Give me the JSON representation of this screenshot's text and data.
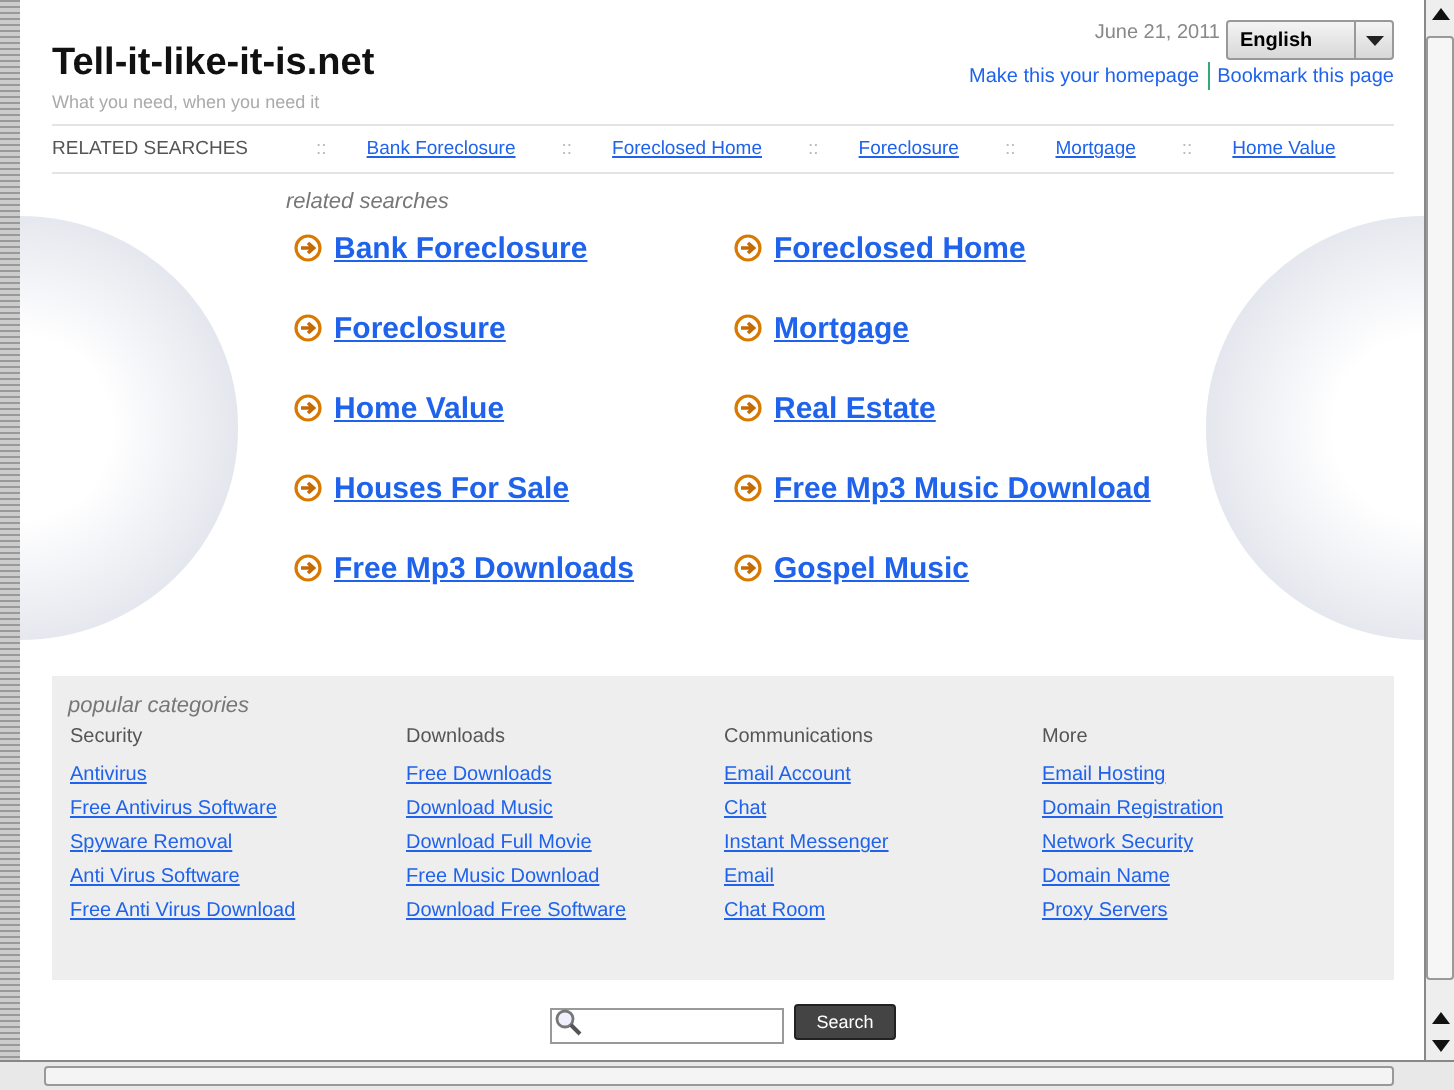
{
  "site": {
    "title": "Tell-it-like-it-is.net",
    "tagline": "What you need, when you need it",
    "date": "June 21, 2011",
    "language": "English",
    "links": [
      "Make this your homepage",
      "Bookmark this page"
    ]
  },
  "related_bar": {
    "label": "RELATED SEARCHES",
    "separator": "::",
    "links": [
      "Bank Foreclosure",
      "Foreclosed Home",
      "Foreclosure",
      "Mortgage",
      "Home Value"
    ]
  },
  "related_searches": {
    "heading": "related searches",
    "links": [
      "Bank Foreclosure",
      "Foreclosed Home",
      "Foreclosure",
      "Mortgage",
      "Home Value",
      "Real Estate",
      "Houses For Sale",
      "Free Mp3 Music Download",
      "Free Mp3 Downloads",
      "Gospel Music"
    ]
  },
  "popular_categories": {
    "heading": "popular categories",
    "columns": [
      {
        "title": "Security",
        "links": [
          "Antivirus",
          "Free Antivirus Software",
          "Spyware Removal",
          "Anti Virus Software",
          "Free Anti Virus Download"
        ]
      },
      {
        "title": "Downloads",
        "links": [
          "Free Downloads",
          "Download Music",
          "Download Full Movie",
          "Free Music Download",
          "Download Free Software"
        ]
      },
      {
        "title": "Communications",
        "links": [
          "Email Account",
          "Chat",
          "Instant Messenger",
          "Email",
          "Chat Room"
        ]
      },
      {
        "title": "More",
        "links": [
          "Email Hosting",
          "Domain Registration",
          "Network Security",
          "Domain Name",
          "Proxy Servers"
        ]
      }
    ]
  },
  "search": {
    "button": "Search"
  }
}
